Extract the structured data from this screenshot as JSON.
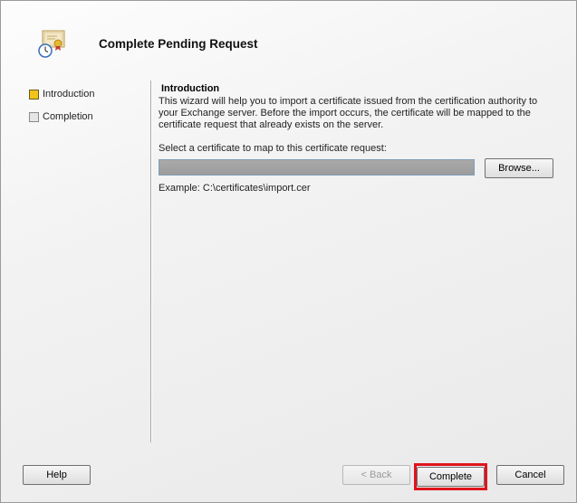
{
  "header": {
    "title": "Complete Pending Request",
    "icon": "certificate-icon"
  },
  "nav": {
    "items": [
      {
        "label": "Introduction",
        "state": "active"
      },
      {
        "label": "Completion",
        "state": "inactive"
      }
    ]
  },
  "content": {
    "heading": "Introduction",
    "description": "This wizard will help you to import a certificate issued from the certification authority to your Exchange server. Before the import occurs, the certificate will be mapped to the certificate request that already exists on the server.",
    "field_label": "Select a certificate to map to this certificate request:",
    "field_value": "",
    "browse_label": "Browse...",
    "example": "Example: C:\\certificates\\import.cer"
  },
  "footer": {
    "help_label": "Help",
    "back_label": "< Back",
    "complete_label": "Complete",
    "cancel_label": "Cancel"
  },
  "colors": {
    "active_bullet": "#f0c419",
    "highlight": "#e0151d"
  }
}
